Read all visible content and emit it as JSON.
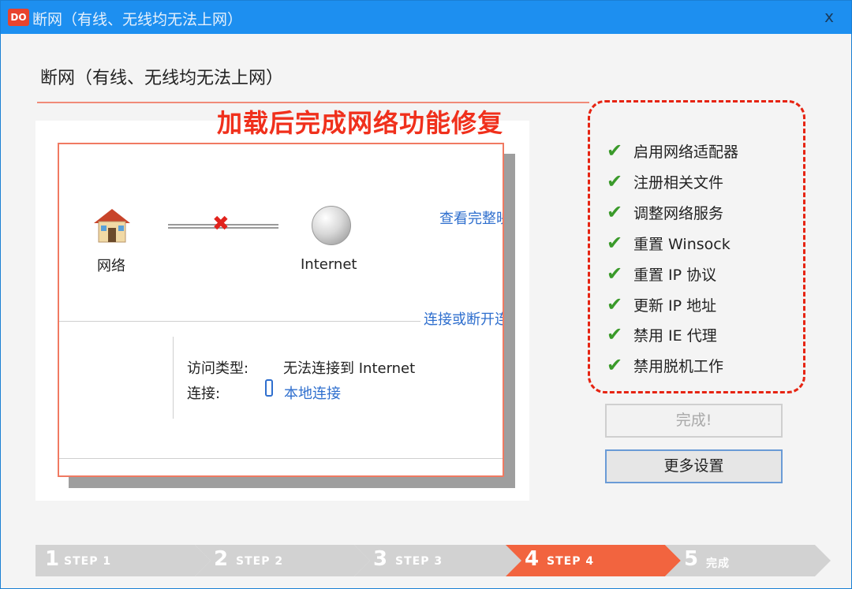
{
  "window": {
    "app_icon_text": "DO",
    "title": "断网（有线、无线均无法上网）",
    "close_label": "x"
  },
  "heading": "断网（有线、无线均无法上网）",
  "banner": "加载后完成网络功能修复",
  "preview": {
    "network_label": "网络",
    "internet_label": "Internet",
    "view_link": "查看完整映",
    "connect_link": "连接或断开连",
    "access_type_key": "访问类型:",
    "access_type_value": "无法连接到 Internet",
    "connection_key": "连接:",
    "connection_value": "本地连接"
  },
  "checklist": [
    {
      "label": "启用网络适配器",
      "status": "done"
    },
    {
      "label": "注册相关文件",
      "status": "done"
    },
    {
      "label": "调整网络服务",
      "status": "done"
    },
    {
      "label": "重置 Winsock",
      "status": "done"
    },
    {
      "label": "重置 IP 协议",
      "status": "done"
    },
    {
      "label": "更新 IP 地址",
      "status": "done"
    },
    {
      "label": "禁用 IE 代理",
      "status": "done"
    },
    {
      "label": "禁用脱机工作",
      "status": "done"
    }
  ],
  "buttons": {
    "done": "完成!",
    "more": "更多设置"
  },
  "steps": [
    {
      "num": "1",
      "label": "STEP 1",
      "active": false
    },
    {
      "num": "2",
      "label": "STEP 2",
      "active": false
    },
    {
      "num": "3",
      "label": "STEP 3",
      "active": false
    },
    {
      "num": "4",
      "label": "STEP 4",
      "active": true
    },
    {
      "num": "5",
      "label": "完成",
      "active": false
    }
  ],
  "colors": {
    "titlebar": "#1d8ff0",
    "banner": "#f0301c",
    "check": "#3a9a2a",
    "active_step": "#f2643f",
    "link": "#2f6fce"
  },
  "icons": {
    "app": "app-logo-icon",
    "close": "close-icon",
    "network": "house-icon",
    "broken": "x-icon",
    "internet": "globe-icon",
    "connection": "ethernet-icon",
    "check": "checkmark-icon"
  }
}
